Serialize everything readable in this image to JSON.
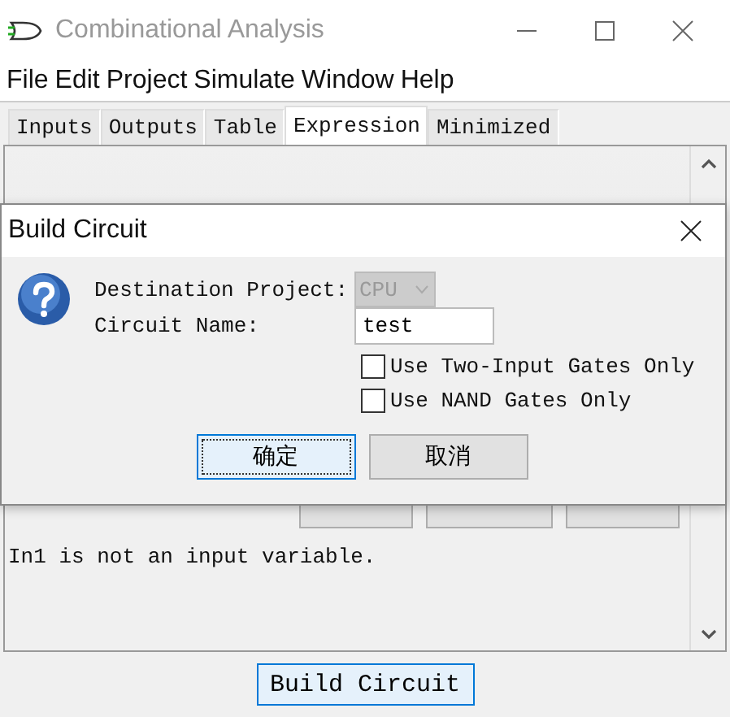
{
  "window": {
    "title": "Combinational Analysis"
  },
  "menu": [
    "File",
    "Edit",
    "Project",
    "Simulate",
    "Window",
    "Help"
  ],
  "tabs": [
    {
      "label": "Inputs",
      "selected": false
    },
    {
      "label": "Outputs",
      "selected": false
    },
    {
      "label": "Table",
      "selected": false
    },
    {
      "label": "Expression",
      "selected": true
    },
    {
      "label": "Minimized",
      "selected": false
    }
  ],
  "expression_panel": {
    "message": "In1 is not an input variable."
  },
  "build_button": "Build Circuit",
  "dialog": {
    "title": "Build Circuit",
    "fields": [
      {
        "kind": "combo",
        "label": "Destination Project:",
        "value": "CPU",
        "disabled": true
      },
      {
        "kind": "text",
        "label": "Circuit Name:",
        "value": "test"
      }
    ],
    "options": [
      {
        "label": "Use Two-Input Gates Only",
        "checked": false
      },
      {
        "label": "Use NAND Gates Only",
        "checked": false
      }
    ],
    "buttons": [
      {
        "label": "确定",
        "focused": true
      },
      {
        "label": "取消",
        "focused": false
      }
    ]
  }
}
